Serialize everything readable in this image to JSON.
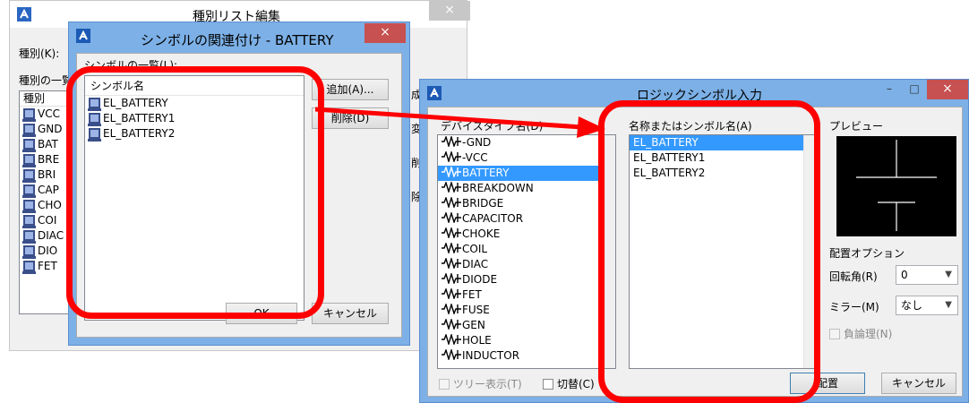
{
  "win_back": {
    "title": "種別リスト編集",
    "close_label": "×",
    "kind_label": "種別(K):",
    "kind_list_label": "種別の一覧",
    "header_kind": "種別",
    "items": [
      "VCC",
      "GND",
      "BAT",
      "BRE",
      "BRI",
      "CAP",
      "CHO",
      "COI",
      "DIAC",
      "DIO",
      "FET"
    ],
    "side_chars": [
      "成",
      "変",
      "削",
      "除"
    ]
  },
  "win_assoc": {
    "title": "シンボルの関連付け - BATTERY",
    "close_label": "×",
    "list_label": "シンボルの一覧(L):",
    "col_header": "シンボル名",
    "symbols": [
      "EL_BATTERY",
      "EL_BATTERY1",
      "EL_BATTERY2"
    ],
    "add_button": "追加(A)...",
    "delete_button": "削除(D)",
    "ok_button": "OK",
    "cancel_button": "キャンセル"
  },
  "win_logic": {
    "title": "ロジックシンボル入力",
    "min_label": "–",
    "max_label": "□",
    "close_label": "×",
    "device_label": "デバイスタイプ名(D)",
    "devices": [
      "-GND",
      "-VCC",
      "BATTERY",
      "BREAKDOWN",
      "BRIDGE",
      "CAPACITOR",
      "CHOKE",
      "COIL",
      "DIAC",
      "DIODE",
      "FET",
      "FUSE",
      "GEN",
      "HOLE",
      "INDUCTOR"
    ],
    "selected_device": "BATTERY",
    "symbol_label": "名称またはシンボル名(A)",
    "symbols": [
      "EL_BATTERY",
      "EL_BATTERY1",
      "EL_BATTERY2"
    ],
    "preview_label": "プレビュー",
    "placement_options_label": "配置オプション",
    "rotation_label": "回転角(R)",
    "rotation_value": "0",
    "mirror_label": "ミラー(M)",
    "mirror_value": "なし",
    "negative_logic_label": "負論理(N)",
    "tree_view_label": "ツリー表示(T)",
    "toggle_label": "切替(C)",
    "place_button": "配置",
    "cancel_button": "キャンセル"
  },
  "colors": {
    "highlight": "#ff0000",
    "selection": "#3399ff",
    "window_frame": "#7cb0e6",
    "close_red": "#c75050"
  }
}
